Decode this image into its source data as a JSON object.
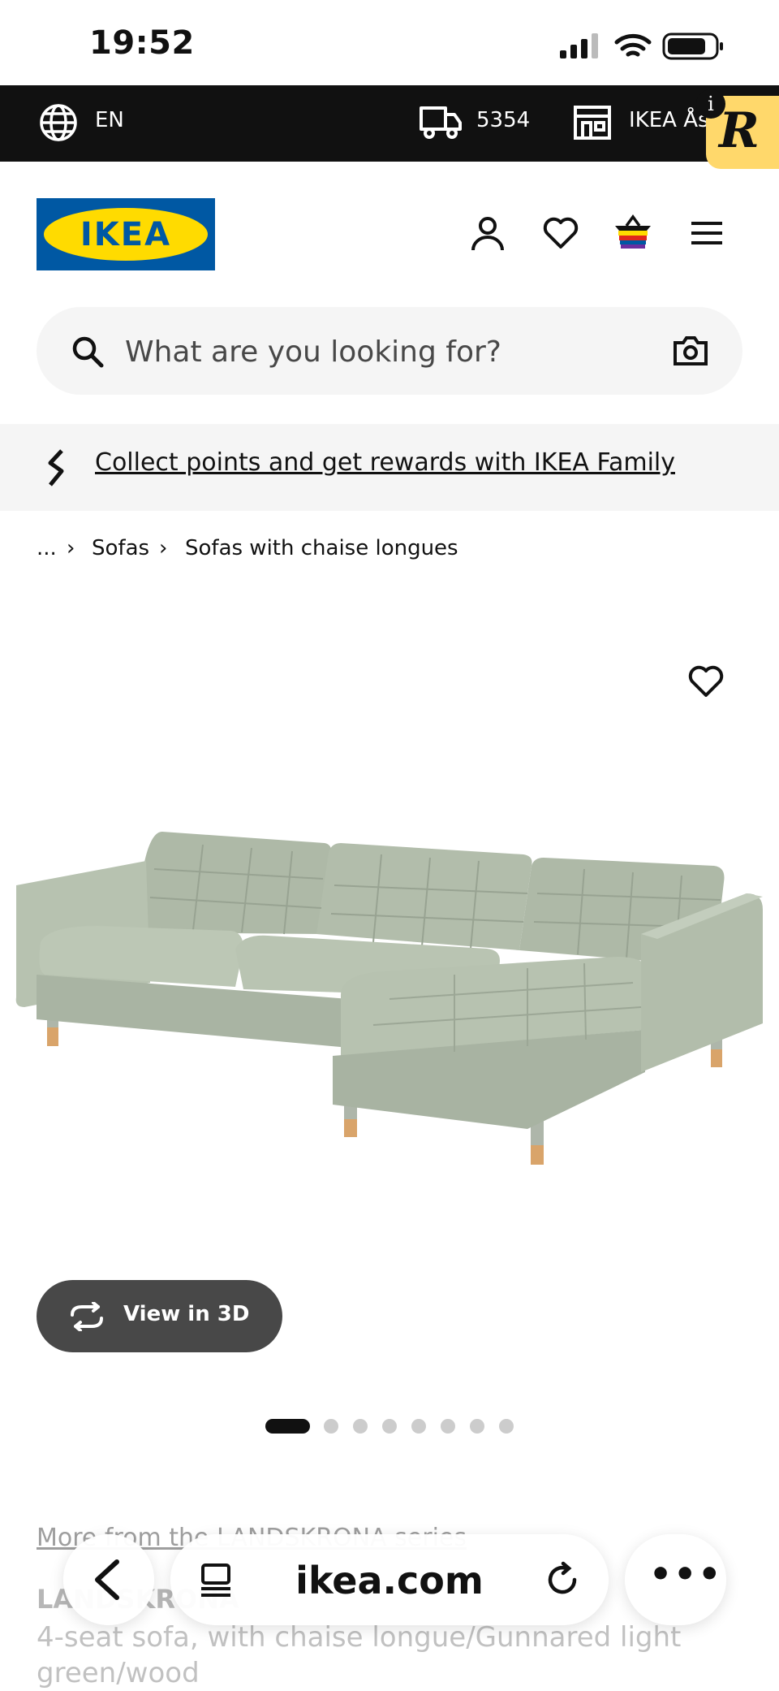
{
  "status_bar": {
    "time": "19:52"
  },
  "top_bar": {
    "language": "EN",
    "postcode": "5354",
    "store": "IKEA Ås"
  },
  "header": {
    "logo_text": "IKEA"
  },
  "search": {
    "placeholder": "What are you looking for?"
  },
  "family_banner": {
    "text": "Collect points and get rewards with IKEA Family"
  },
  "breadcrumb": {
    "ellipsis": "...",
    "items": [
      "Sofas",
      "Sofas with chaise longues"
    ]
  },
  "gallery": {
    "view_3d_label": "View in 3D",
    "image_count": 8,
    "active_index": 1
  },
  "product": {
    "series_link": "More from the LANDSKRONA series",
    "name": "LANDSKRONA",
    "description": "4-seat sofa, with chaise longue/Gunnared light green/wood"
  },
  "browser": {
    "domain": "ikea.com",
    "more_label": "•••"
  },
  "extension": {
    "badge_letter": "R",
    "info": "i"
  },
  "colors": {
    "ikea_blue": "#0058a3",
    "ikea_yellow": "#ffdb00",
    "sofa": "#b7c2b0"
  }
}
